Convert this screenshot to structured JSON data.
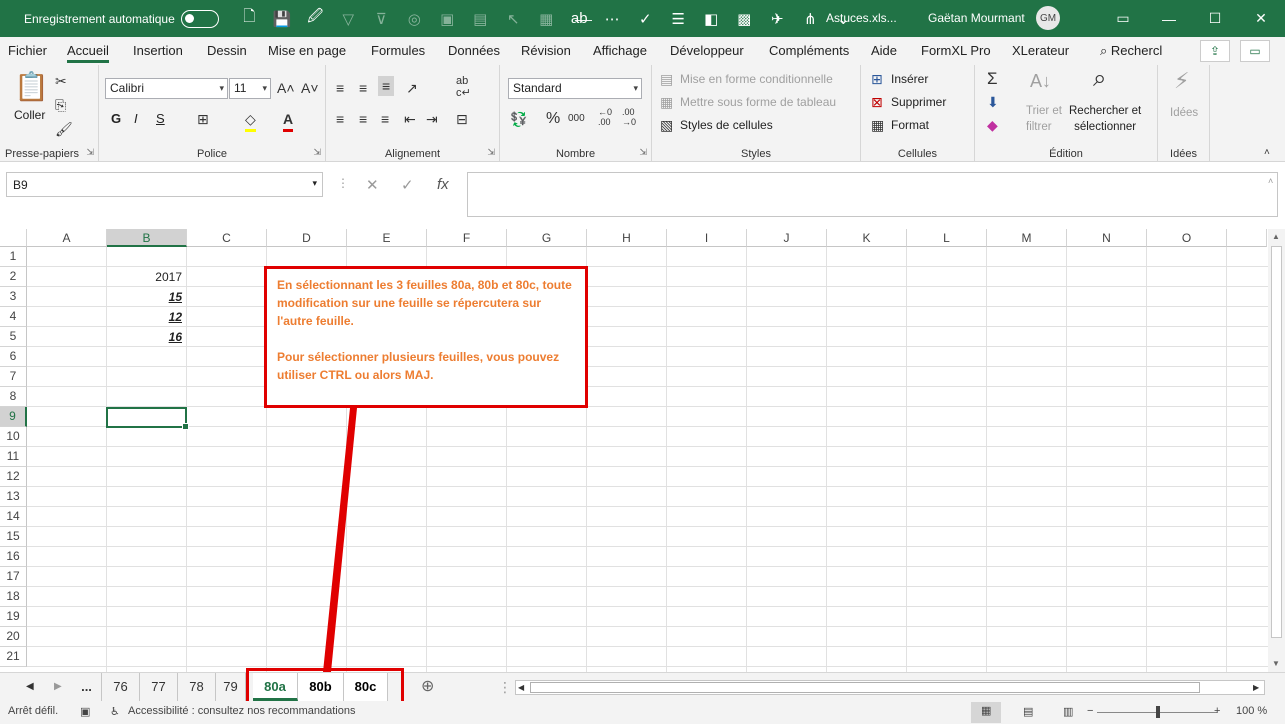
{
  "titlebar": {
    "autosave_label": "Enregistrement automatique",
    "filename": "Astuces.xls...",
    "user_name": "Gaëtan Mourmant",
    "user_initials": "GM",
    "minimize": "—",
    "maximize": "☐",
    "close": "✕"
  },
  "menu": {
    "tabs": [
      "Fichier",
      "Accueil",
      "Insertion",
      "Dessin",
      "Mise en page",
      "Formules",
      "Données",
      "Révision",
      "Affichage",
      "Développeur",
      "Compléments",
      "Aide",
      "FormXL Pro",
      "XLerateur"
    ],
    "active": "Accueil",
    "search": "Rechercl"
  },
  "ribbon": {
    "clipboard": {
      "label": "Presse-papiers",
      "paste": "Coller"
    },
    "font": {
      "label": "Police",
      "font_name": "Calibri",
      "font_size": "11",
      "bold": "G",
      "italic": "I",
      "underline": "S"
    },
    "alignment": {
      "label": "Alignement"
    },
    "number": {
      "label": "Nombre",
      "format": "Standard"
    },
    "styles": {
      "label": "Styles",
      "cond_format": "Mise en forme conditionnelle",
      "table_format": "Mettre sous forme de tableau",
      "cell_styles": "Styles de cellules"
    },
    "cells": {
      "label": "Cellules",
      "insert": "Insérer",
      "delete": "Supprimer",
      "format": "Format"
    },
    "editing": {
      "label": "Édition",
      "sort_1": "Trier et",
      "sort_2": "filtrer",
      "find_1": "Rechercher et",
      "find_2": "sélectionner"
    },
    "ideas": {
      "label": "Idées",
      "button": "Idées"
    }
  },
  "formula_bar": {
    "name_box": "B9",
    "formula": ""
  },
  "grid": {
    "columns": [
      "A",
      "B",
      "C",
      "D",
      "E",
      "F",
      "G",
      "H",
      "I",
      "J",
      "K",
      "L",
      "M",
      "N",
      "O"
    ],
    "rows": [
      "1",
      "2",
      "3",
      "4",
      "5",
      "6",
      "7",
      "8",
      "9",
      "10",
      "11",
      "12",
      "13",
      "14",
      "15",
      "16",
      "17",
      "18",
      "19",
      "20",
      "21"
    ],
    "selected_cell": "B9",
    "cells": {
      "B2": "2017",
      "B3": "15",
      "B4": "12",
      "B5": "16"
    }
  },
  "callout": {
    "line1": "En sélectionnant les 3 feuilles 80a, 80b et 80c, toute modification sur une feuille se répercutera sur l'autre feuille.",
    "line2": "Pour sélectionner plusieurs feuilles, vous pouvez utiliser CTRL ou alors MAJ."
  },
  "sheets": {
    "ellipsis": "...",
    "tabs": [
      "76",
      "77",
      "78",
      "79",
      "80a",
      "80b",
      "80c"
    ],
    "selected": [
      "80a",
      "80b",
      "80c"
    ],
    "active": "80a"
  },
  "status": {
    "mode": "Arrêt défil.",
    "accessibility": "Accessibilité : consultez nos recommandations",
    "zoom": "100 %"
  },
  "colors": {
    "excel_green": "#217346",
    "callout_border": "#e00000",
    "callout_text": "#ed7d31"
  }
}
